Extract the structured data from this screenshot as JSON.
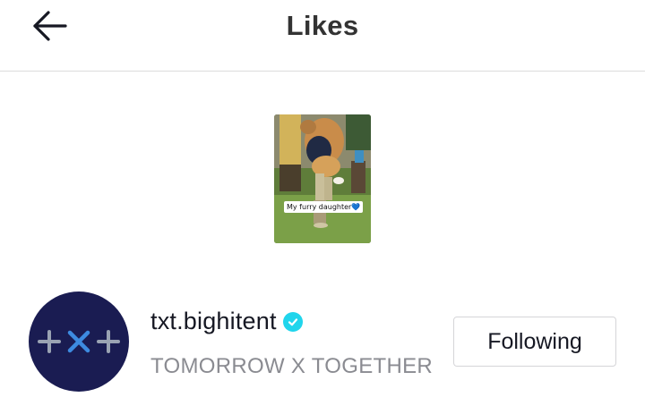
{
  "header": {
    "title": "Likes",
    "back_icon": "arrow-left-icon"
  },
  "liked_video": {
    "caption": "My furry daughter",
    "caption_emoji": "💙"
  },
  "account": {
    "username": "txt.bighitent",
    "nickname": "TOMORROW X TOGETHER",
    "verified_icon": "verified-badge-icon",
    "verified_color": "#20d5ec",
    "avatar_color": "#1a1c52",
    "follow_label": "Following"
  }
}
